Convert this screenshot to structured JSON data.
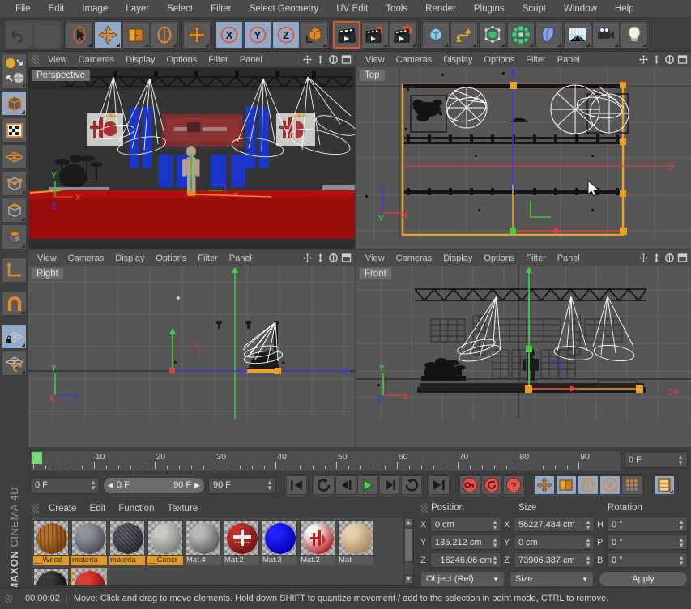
{
  "menu": {
    "items": [
      "File",
      "Edit",
      "Image",
      "Layer",
      "Select",
      "Filter",
      "Select Geometry",
      "UV Edit",
      "Tools",
      "Render",
      "Plugins",
      "Script",
      "Window",
      "Help"
    ]
  },
  "toolbar": {
    "groups": [
      {
        "name": "history",
        "buttons": [
          {
            "icon": "undo-icon",
            "label": "Undo",
            "state": "disabled"
          },
          {
            "icon": "redo-icon",
            "label": "Redo",
            "state": "disabled"
          }
        ]
      },
      {
        "name": "transform",
        "buttons": [
          {
            "icon": "select-arrow-icon",
            "label": "Live Selection",
            "state": "normal"
          },
          {
            "icon": "move-icon",
            "label": "Move",
            "state": "active"
          },
          {
            "icon": "scale-icon",
            "label": "Scale",
            "state": "normal"
          },
          {
            "icon": "rotate-icon",
            "label": "Rotate",
            "state": "normal"
          }
        ]
      },
      {
        "name": "world-axis",
        "buttons": [
          {
            "icon": "axis-move-icon",
            "label": "World/Object Axis",
            "state": "normal"
          }
        ]
      },
      {
        "name": "axis-lock",
        "buttons": [
          {
            "icon": "x-axis-icon",
            "label": "X Axis Lock",
            "state": "active"
          },
          {
            "icon": "y-axis-icon",
            "label": "Y Axis Lock",
            "state": "active"
          },
          {
            "icon": "z-axis-icon",
            "label": "Z Axis Lock",
            "state": "active"
          },
          {
            "icon": "world-coord-icon",
            "label": "World Coordinate System",
            "state": "normal"
          }
        ]
      },
      {
        "name": "render",
        "buttons": [
          {
            "icon": "render-view-icon",
            "label": "Render View",
            "state": "selected"
          },
          {
            "icon": "render-picture-viewer-icon",
            "label": "Render to Picture Viewer",
            "state": "normal"
          },
          {
            "icon": "render-settings-icon",
            "label": "Edit Render Settings",
            "state": "normal"
          }
        ]
      },
      {
        "name": "create",
        "buttons": [
          {
            "icon": "cube-primitive-icon",
            "label": "Add Cube Object",
            "state": "normal"
          },
          {
            "icon": "spline-icon",
            "label": "Add Spline",
            "state": "normal"
          },
          {
            "icon": "hypernurbs-icon",
            "label": "Add HyperNURBS",
            "state": "normal"
          },
          {
            "icon": "array-icon",
            "label": "Add Array",
            "state": "normal"
          },
          {
            "icon": "deformer-icon",
            "label": "Add Bend Deformer",
            "state": "normal"
          },
          {
            "icon": "floor-icon",
            "label": "Add Floor",
            "state": "normal"
          },
          {
            "icon": "camera-icon",
            "label": "Add Camera",
            "state": "normal"
          },
          {
            "icon": "light-icon",
            "label": "Add Light",
            "state": "normal"
          }
        ]
      }
    ]
  },
  "left_toolbar": {
    "buttons": [
      {
        "icon": "texture-axis-icon",
        "label": "Texture / Object Axis",
        "state": "normal"
      },
      {
        "icon": "model-mode-icon",
        "label": "Model Mode",
        "state": "active"
      },
      {
        "icon": "texture-mode-icon",
        "label": "Texture Mode",
        "state": "normal"
      },
      {
        "icon": "polygon-mesh-icon",
        "label": "Polygon Mesh Mode",
        "state": "normal"
      },
      {
        "icon": "points-mode-icon",
        "label": "Points Mode",
        "state": "normal"
      },
      {
        "icon": "edges-mode-icon",
        "label": "Edges Mode",
        "state": "normal"
      },
      {
        "icon": "polygons-mode-icon",
        "label": "Polygons Mode",
        "state": "normal"
      },
      {
        "icon": "object-axis-icon",
        "label": "Enable Axis Modification",
        "state": "normal"
      },
      {
        "icon": "magnet-icon",
        "label": "Magnet Tool",
        "state": "normal"
      },
      {
        "icon": "lock-workplane-icon",
        "label": "Lock Workplane",
        "state": "active"
      },
      {
        "icon": "workplane-snap-icon",
        "label": "Workplane Snap",
        "state": "normal"
      }
    ],
    "branding": {
      "maxon": "MAXON",
      "product": "CINEMA 4D"
    }
  },
  "viewport_menu": [
    "View",
    "Cameras",
    "Display",
    "Options",
    "Filter",
    "Panel"
  ],
  "viewport_icons": [
    {
      "icon": "pan-icon",
      "label": "Move camera"
    },
    {
      "icon": "dolly-icon",
      "label": "Dolly camera"
    },
    {
      "icon": "orbit-icon",
      "label": "Rotate camera"
    },
    {
      "icon": "maximize-view-icon",
      "label": "Toggle Active View"
    }
  ],
  "viewports": [
    {
      "name": "perspective-viewport",
      "label": "Perspective",
      "axes": {
        "x": "X",
        "y": "Y",
        "z": "Z"
      }
    },
    {
      "name": "top-viewport",
      "label": "Top",
      "axes": {
        "x": "X",
        "y": "Y",
        "z": "Z"
      }
    },
    {
      "name": "right-viewport",
      "label": "Right",
      "axes": {
        "x": "X",
        "y": "Y",
        "z": "Z"
      }
    },
    {
      "name": "front-viewport",
      "label": "Front",
      "axes": {
        "x": "X",
        "y": "Y",
        "z": "Z"
      }
    }
  ],
  "timeline": {
    "ticks": [
      "0",
      "10",
      "20",
      "30",
      "40",
      "50",
      "60",
      "70",
      "80",
      "90"
    ],
    "current_frame": "0 F",
    "end_field": "0 F",
    "range_start": "0 F",
    "range_end": "90 F",
    "preview_end": "90 F",
    "playback_buttons": [
      {
        "icon": "go-to-start-icon",
        "label": "Go to Start"
      },
      {
        "icon": "loop-icon",
        "label": "Play Mode / Loop"
      },
      {
        "icon": "step-back-icon",
        "label": "Go to Previous Frame"
      },
      {
        "icon": "play-icon",
        "label": "Play Forward"
      },
      {
        "icon": "step-forward-icon",
        "label": "Go to Next Frame"
      },
      {
        "icon": "revert-icon",
        "label": "Playback Reverse"
      },
      {
        "icon": "go-to-end-icon",
        "label": "Go to End"
      }
    ],
    "key_buttons": [
      {
        "icon": "record-key-icon",
        "label": "Record Active Objects"
      },
      {
        "icon": "autokey-icon",
        "label": "Autokeying"
      },
      {
        "icon": "keyframe-selection-icon",
        "label": "Keyframe Selection"
      }
    ],
    "track_toggles": [
      {
        "icon": "position-key-icon",
        "label": "Position",
        "state": "active"
      },
      {
        "icon": "scale-key-icon",
        "label": "Scale",
        "state": "active"
      },
      {
        "icon": "rotation-key-icon",
        "label": "Rotation",
        "state": "active"
      },
      {
        "icon": "parameter-key-icon",
        "label": "Parameter",
        "state": "active"
      },
      {
        "icon": "point-level-anim-icon",
        "label": "Point Level Animation",
        "state": "normal"
      }
    ],
    "extra_button": {
      "icon": "timeline-filmstrip-icon",
      "label": "Make Preview / Timeline",
      "state": "active"
    }
  },
  "material_manager": {
    "menu": [
      "Create",
      "Edit",
      "Function",
      "Texture"
    ],
    "materials": [
      {
        "name": "__Wood",
        "color1": "#b5712c",
        "color2": "#7a430f",
        "highlighted": true,
        "selected": false,
        "style": "wood"
      },
      {
        "name": "materia",
        "color1": "#8e939c",
        "color2": "#4a4e57",
        "highlighted": true,
        "selected": false,
        "style": "plain"
      },
      {
        "name": "materia",
        "color1": "#5d6470",
        "color2": "#2f343d",
        "highlighted": true,
        "selected": false,
        "style": "bumpy"
      },
      {
        "name": "__Concr",
        "color1": "#c9c9c4",
        "color2": "#7e7e79",
        "highlighted": true,
        "selected": false,
        "style": "plain"
      },
      {
        "name": "Mat.4",
        "color1": "#b9b9b9",
        "color2": "#5a5a5a",
        "highlighted": false,
        "selected": false,
        "style": "plain"
      },
      {
        "name": "Mat.2",
        "color1": "#c0302a",
        "color2": "#6d1511",
        "highlighted": false,
        "selected": false,
        "style": "logo-red"
      },
      {
        "name": "Mat.3",
        "color1": "#2222ff",
        "color2": "#0000b4",
        "highlighted": false,
        "selected": false,
        "style": "plain"
      },
      {
        "name": "Mat.2",
        "color1": "#f4f4f4",
        "color2": "#b02020",
        "highlighted": false,
        "selected": false,
        "style": "logo-white"
      },
      {
        "name": "Mat",
        "color1": "#e6cfae",
        "color2": "#a8875f",
        "highlighted": false,
        "selected": false,
        "style": "plain"
      },
      {
        "name": "",
        "color1": "#3a3a3a",
        "color2": "#050505",
        "highlighted": false,
        "selected": false,
        "style": "plain"
      },
      {
        "name": "",
        "color1": "#e03a30",
        "color2": "#7a0c08",
        "highlighted": false,
        "selected": true,
        "style": "plain"
      }
    ]
  },
  "coordinates": {
    "headers": [
      "Position",
      "Size",
      "Rotation"
    ],
    "rows": [
      {
        "pos_label": "X",
        "pos_value": "0 cm",
        "size_label": "X",
        "size_value": "56227.484 cm",
        "rot_label": "H",
        "rot_value": "0 °"
      },
      {
        "pos_label": "Y",
        "pos_value": "135.212 cm",
        "size_label": "Y",
        "size_value": "0 cm",
        "rot_label": "P",
        "rot_value": "0 °"
      },
      {
        "pos_label": "Z",
        "pos_value": "−16246.06 cm",
        "size_label": "Z",
        "size_value": "73906.387 cm",
        "rot_label": "B",
        "rot_value": "0 °"
      }
    ],
    "mode_dropdown": "Object (Rel)",
    "size_dropdown": "Size",
    "apply_button": "Apply"
  },
  "status_bar": {
    "time": "00:00:02",
    "message": "Move: Click and drag to move elements. Hold down SHIFT to quantize movement / add to the selection in point mode, CTRL to remove."
  },
  "colors": {
    "accent_orange": "#e0892a",
    "active_blue": "#93a9c9",
    "selection_orange": "#ffaa22",
    "key_red": "#e0554f",
    "play_green": "#4fd04f"
  }
}
